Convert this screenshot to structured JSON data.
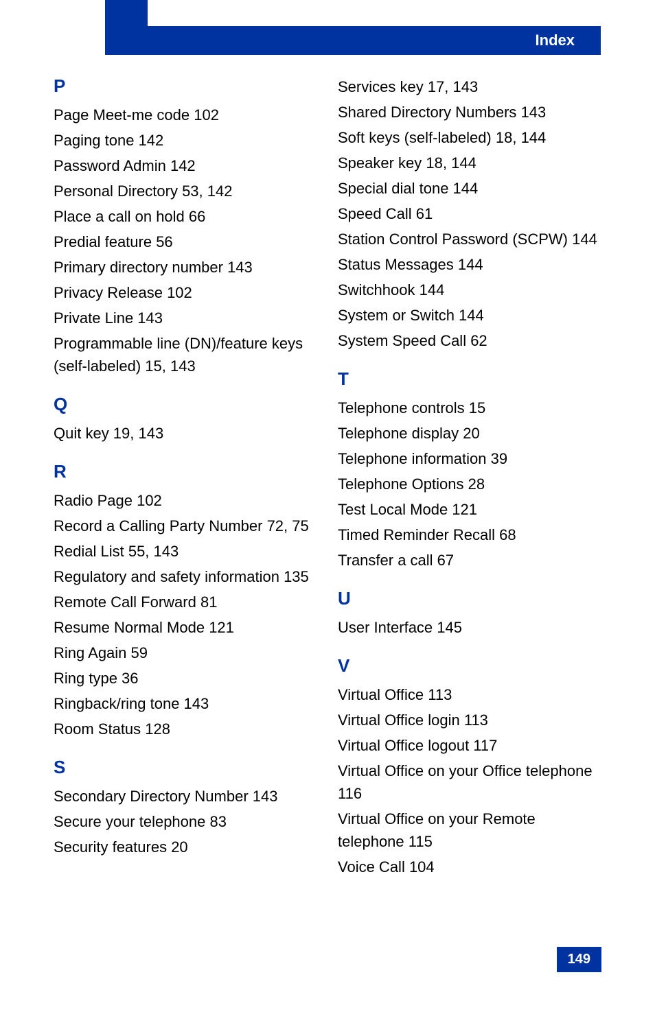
{
  "header": {
    "title": "Index"
  },
  "page_number": "149",
  "left_column": {
    "sections": [
      {
        "letter": "P",
        "entries": [
          "Page Meet-me code 102",
          "Paging tone 142",
          "Password Admin 142",
          "Personal Directory 53, 142",
          "Place a call on hold 66",
          "Predial feature 56",
          "Primary directory number 143",
          "Privacy Release 102",
          "Private Line 143",
          "Programmable line (DN)/feature keys (self-labeled) 15, 143"
        ]
      },
      {
        "letter": "Q",
        "entries": [
          "Quit key 19, 143"
        ]
      },
      {
        "letter": "R",
        "entries": [
          "Radio Page 102",
          "Record a Calling Party Number 72, 75",
          "Redial List 55, 143",
          "Regulatory and safety information 135",
          "Remote Call Forward 81",
          "Resume Normal Mode 121",
          "Ring Again 59",
          "Ring type 36",
          "Ringback/ring tone 143",
          "Room Status 128"
        ]
      },
      {
        "letter": "S",
        "entries": [
          "Secondary Directory Number 143",
          "Secure your telephone 83",
          "Security features 20"
        ]
      }
    ]
  },
  "right_column": {
    "continuation_entries": [
      "Services key 17, 143",
      "Shared Directory Numbers 143",
      "Soft keys (self-labeled) 18, 144",
      "Speaker key 18, 144",
      "Special dial tone 144",
      "Speed Call 61",
      "Station Control Password (SCPW) 144",
      "Status Messages 144",
      "Switchhook 144",
      "System or Switch 144",
      "System Speed Call 62"
    ],
    "sections": [
      {
        "letter": "T",
        "entries": [
          "Telephone controls 15",
          "Telephone display 20",
          "Telephone information 39",
          "Telephone Options 28",
          "Test Local Mode 121",
          "Timed Reminder Recall 68",
          "Transfer a call 67"
        ]
      },
      {
        "letter": "U",
        "entries": [
          "User Interface 145"
        ]
      },
      {
        "letter": "V",
        "entries": [
          "Virtual Office 113",
          "Virtual Office login 113",
          "Virtual Office logout 117",
          "Virtual Office on your Office telephone 116",
          "Virtual Office on your Remote telephone 115",
          "Voice Call 104"
        ]
      }
    ]
  }
}
